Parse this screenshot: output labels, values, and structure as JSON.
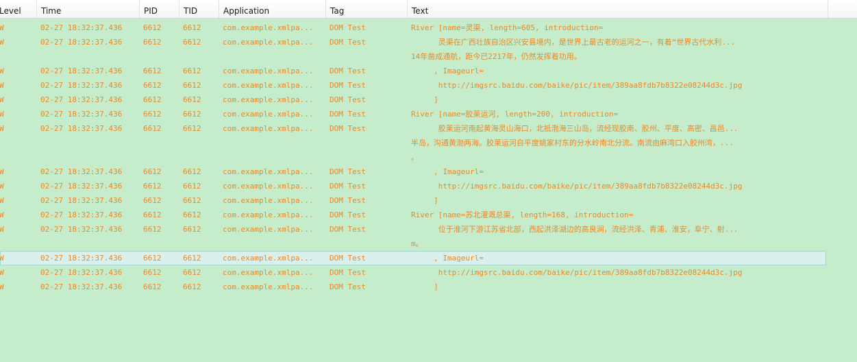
{
  "columns": [
    "Level",
    "Time",
    "PID",
    "TID",
    "Application",
    "Tag",
    "Text"
  ],
  "rows": [
    {
      "level": "W",
      "time": "02-27 18:32:37.436",
      "pid": "6612",
      "tid": "6612",
      "app": "com.example.xmlpa...",
      "tag": "DOM Test",
      "text": "River [name=灵渠, length=605, introduction="
    },
    {
      "level": "W",
      "time": "02-27 18:32:37.436",
      "pid": "6612",
      "tid": "6612",
      "app": "com.example.xmlpa...",
      "tag": "DOM Test",
      "text": "      灵渠在广西壮族自治区兴安县境内，是世界上最古老的运河之一，有着“世界古代水利...",
      "cont": [
        "14年凿成通航，距今已2217年，仍然发挥着功用。"
      ]
    },
    {
      "level": "W",
      "time": "02-27 18:32:37.436",
      "pid": "6612",
      "tid": "6612",
      "app": "com.example.xmlpa...",
      "tag": "DOM Test",
      "text": "     , Imageurl="
    },
    {
      "level": "W",
      "time": "02-27 18:32:37.436",
      "pid": "6612",
      "tid": "6612",
      "app": "com.example.xmlpa...",
      "tag": "DOM Test",
      "text": "      http://imgsrc.baidu.com/baike/pic/item/389aa8fdb7b8322e08244d3c.jpg"
    },
    {
      "level": "W",
      "time": "02-27 18:32:37.436",
      "pid": "6612",
      "tid": "6612",
      "app": "com.example.xmlpa...",
      "tag": "DOM Test",
      "text": "     ]"
    },
    {
      "level": "W",
      "time": "02-27 18:32:37.436",
      "pid": "6612",
      "tid": "6612",
      "app": "com.example.xmlpa...",
      "tag": "DOM Test",
      "text": "River [name=胶莱运河, length=200, introduction="
    },
    {
      "level": "W",
      "time": "02-27 18:32:37.436",
      "pid": "6612",
      "tid": "6612",
      "app": "com.example.xmlpa...",
      "tag": "DOM Test",
      "text": "      胶莱运河南起黄海灵山海口，北抵渤海三山岛，流经现胶南、胶州、平度、高密、昌邑...",
      "cont": [
        "半岛，沟通黄渤两海。胶莱运河自平度姚家村东的分水岭南北分流。南流由麻湾口入胶州湾，...",
        "。"
      ]
    },
    {
      "level": "W",
      "time": "02-27 18:32:37.436",
      "pid": "6612",
      "tid": "6612",
      "app": "com.example.xmlpa...",
      "tag": "DOM Test",
      "text": "     , Imageurl="
    },
    {
      "level": "W",
      "time": "02-27 18:32:37.436",
      "pid": "6612",
      "tid": "6612",
      "app": "com.example.xmlpa...",
      "tag": "DOM Test",
      "text": "      http://imgsrc.baidu.com/baike/pic/item/389aa8fdb7b8322e08244d3c.jpg"
    },
    {
      "level": "W",
      "time": "02-27 18:32:37.436",
      "pid": "6612",
      "tid": "6612",
      "app": "com.example.xmlpa...",
      "tag": "DOM Test",
      "text": "     ]"
    },
    {
      "level": "W",
      "time": "02-27 18:32:37.436",
      "pid": "6612",
      "tid": "6612",
      "app": "com.example.xmlpa...",
      "tag": "DOM Test",
      "text": "River [name=苏北灌溉总渠, length=168, introduction="
    },
    {
      "level": "W",
      "time": "02-27 18:32:37.436",
      "pid": "6612",
      "tid": "6612",
      "app": "com.example.xmlpa...",
      "tag": "DOM Test",
      "text": "      位于淮河下游江苏省北部，西起洪泽湖边的高良涧，流经洪泽、青浦、淮安，阜宁、射...",
      "cont": [
        "m。"
      ]
    },
    {
      "level": "W",
      "time": "02-27 18:32:37.436",
      "pid": "6612",
      "tid": "6612",
      "app": "com.example.xmlpa...",
      "tag": "DOM Test",
      "text": "     , Imageurl=",
      "selected": true
    },
    {
      "level": "W",
      "time": "02-27 18:32:37.436",
      "pid": "6612",
      "tid": "6612",
      "app": "com.example.xmlpa...",
      "tag": "DOM Test",
      "text": "      http://imgsrc.baidu.com/baike/pic/item/389aa8fdb7b8322e08244d3c.jpg"
    },
    {
      "level": "W",
      "time": "02-27 18:32:37.436",
      "pid": "6612",
      "tid": "6612",
      "app": "com.example.xmlpa...",
      "tag": "DOM Test",
      "text": "     ]"
    }
  ],
  "colors": {
    "background": "#c6edcb",
    "log_text": "#e8892a",
    "selected_row": "#d9f0ec"
  }
}
